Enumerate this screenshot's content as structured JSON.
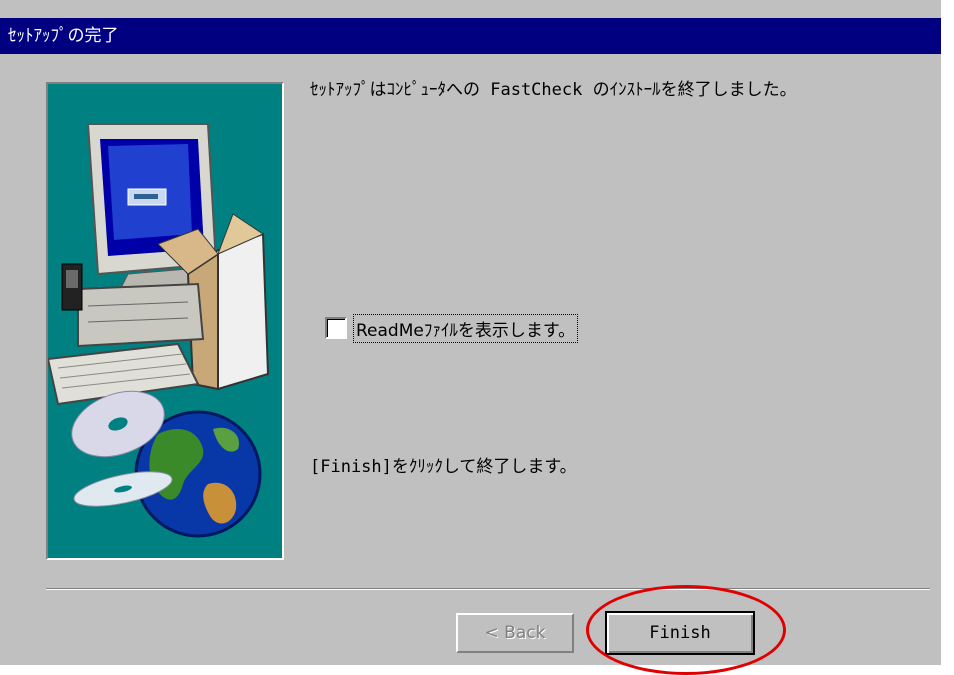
{
  "window": {
    "title": "ｾｯﾄｱｯﾌﾟの完了"
  },
  "content": {
    "message": "ｾｯﾄｱｯﾌﾟはｺﾝﾋﾟｭｰﾀへの FastCheck のｲﾝｽﾄｰﾙを終了しました。",
    "readme_checkbox_label": "ReadMeﾌｧｲﾙを表示します。",
    "readme_checked": false,
    "finish_instruction": "[Finish]をｸﾘｯｸして終了します。"
  },
  "buttons": {
    "back_label": "< Back",
    "finish_label": "Finish"
  },
  "colors": {
    "titlebar": "#000080",
    "dialog_bg": "#c0c0c0",
    "illustration_bg": "#008080",
    "annotation": "#e00000"
  }
}
